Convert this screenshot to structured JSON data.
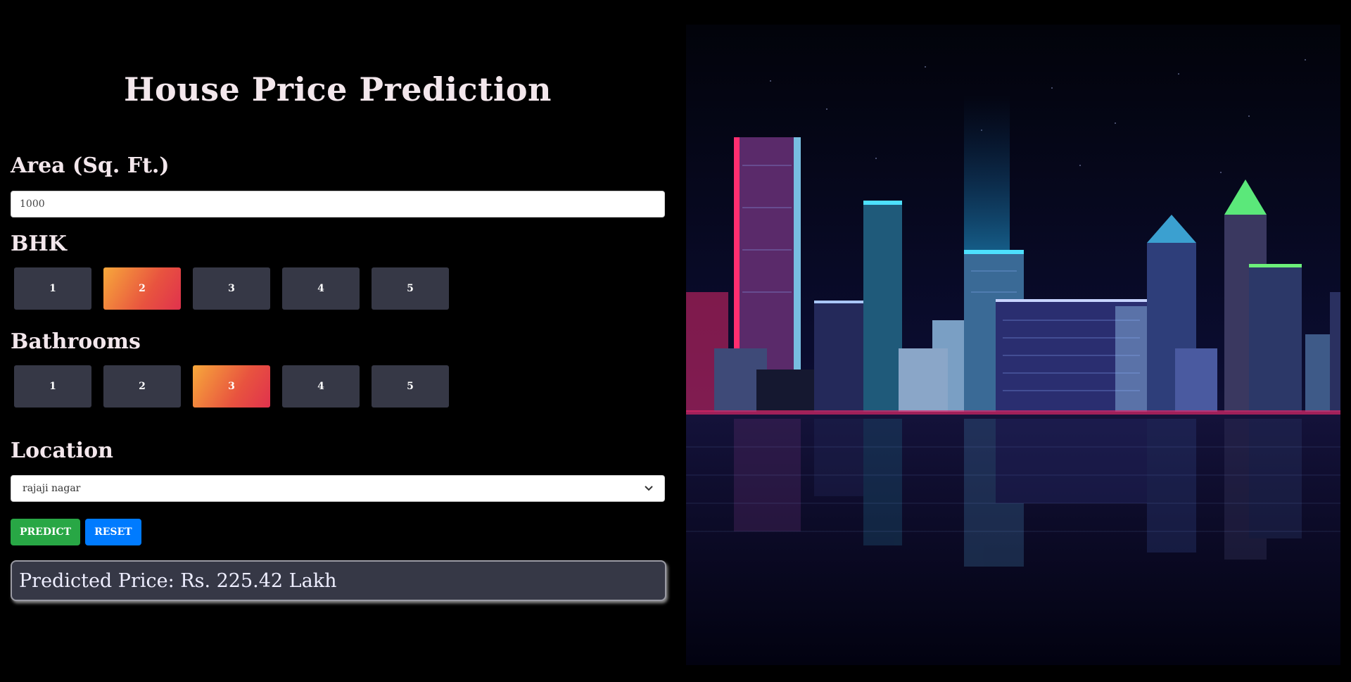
{
  "title": "House Price Prediction",
  "area": {
    "label": "Area (Sq. Ft.)",
    "value": "1000"
  },
  "bhk": {
    "label": "BHK",
    "options": [
      "1",
      "2",
      "3",
      "4",
      "5"
    ],
    "selected": "2"
  },
  "bathrooms": {
    "label": "Bathrooms",
    "options": [
      "1",
      "2",
      "3",
      "4",
      "5"
    ],
    "selected": "3"
  },
  "location": {
    "label": "Location",
    "selected": "rajaji nagar"
  },
  "buttons": {
    "predict": "PREDICT",
    "reset": "RESET"
  },
  "result": "Predicted Price: Rs. 225.42 Lakh",
  "colors": {
    "background": "#000000",
    "option_bg": "#363846",
    "option_active_start": "#f7a83b",
    "option_active_end": "#e0324d",
    "predict": "#28a745",
    "reset": "#007bff"
  },
  "image": {
    "icon": "city-skyline-illustration"
  }
}
